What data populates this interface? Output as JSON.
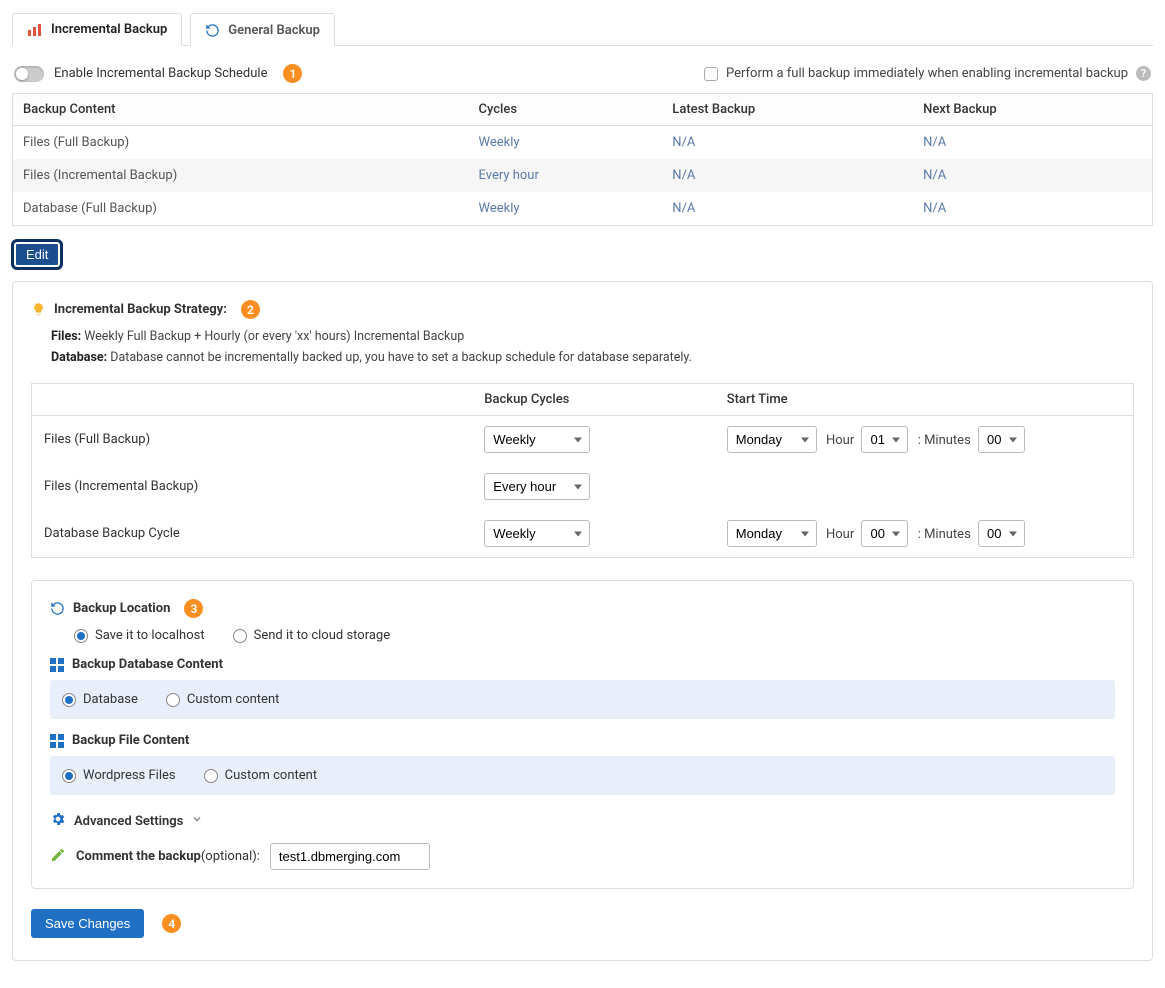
{
  "tabs": {
    "incremental": "Incremental Backup",
    "general": "General Backup"
  },
  "enable_label": "Enable Incremental Backup Schedule",
  "step1": "1",
  "full_on_enable_label": "Perform a full backup immediately when enabling incremental backup",
  "schedule_table": {
    "headers": {
      "content": "Backup Content",
      "cycles": "Cycles",
      "latest": "Latest Backup",
      "next": "Next Backup"
    },
    "rows": [
      {
        "content": "Files (Full Backup)",
        "cycles": "Weekly",
        "latest": "N/A",
        "next": "N/A"
      },
      {
        "content": "Files (Incremental Backup)",
        "cycles": "Every hour",
        "latest": "N/A",
        "next": "N/A"
      },
      {
        "content": "Database (Full Backup)",
        "cycles": "Weekly",
        "latest": "N/A",
        "next": "N/A"
      }
    ]
  },
  "edit_label": "Edit",
  "strategy": {
    "title": "Incremental Backup Strategy:",
    "step2": "2",
    "files_label": "Files:",
    "files_text": " Weekly Full Backup + Hourly (or every 'xx' hours) Incremental Backup",
    "db_label": "Database:",
    "db_text": " Database cannot be incrementally backed up, you have to set a backup schedule for database separately.",
    "headers": {
      "cycles": "Backup Cycles",
      "start": "Start Time"
    },
    "rows": {
      "files_full": {
        "label": "Files (Full Backup)",
        "cycle": "Weekly",
        "day": "Monday",
        "hour": "01",
        "min": "00"
      },
      "files_inc": {
        "label": "Files (Incremental Backup)",
        "cycle": "Every hour"
      },
      "db": {
        "label": "Database Backup Cycle",
        "cycle": "Weekly",
        "day": "Monday",
        "hour": "00",
        "min": "00"
      }
    },
    "hour_label": "Hour",
    "minutes_label": ": Minutes"
  },
  "location": {
    "title": "Backup Location",
    "step3": "3",
    "localhost": "Save it to localhost",
    "cloud": "Send it to cloud storage"
  },
  "db_content": {
    "title": "Backup Database Content",
    "database": "Database",
    "custom": "Custom content"
  },
  "file_content": {
    "title": "Backup File Content",
    "wp": "Wordpress Files",
    "custom": "Custom content"
  },
  "advanced_label": "Advanced Settings",
  "comment_label": "Comment the backup",
  "comment_optional": "(optional):",
  "comment_value": "test1.dbmerging.com",
  "save_label": "Save Changes",
  "step4": "4"
}
